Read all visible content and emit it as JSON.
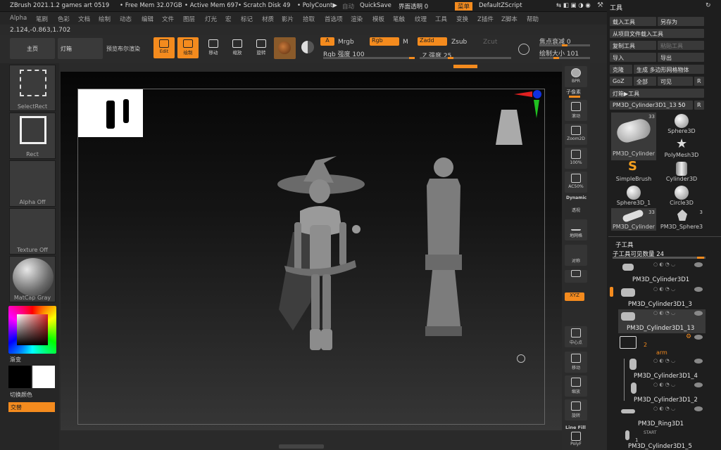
{
  "titlebar": {
    "app": "ZBrush 2021.1.2 games art 0519",
    "free_mem": "• Free Mem 32.07GB",
    "active_mem": "• Active Mem 697",
    "scratch": "• Scratch Disk 49",
    "polycount": "• PolyCount▶",
    "auto": "自动",
    "quicksave": "QuickSave",
    "transparency": "界面透明 0",
    "menu_btn": "菜单",
    "script": "DefaultZScript"
  },
  "menu": [
    "Alpha",
    "笔刷",
    "色彩",
    "文档",
    "绘制",
    "动态",
    "编辑",
    "文件",
    "图层",
    "灯光",
    "宏",
    "标记",
    "材质",
    "影片",
    "拾取",
    "首选项",
    "渲染",
    "模板",
    "笔触",
    "纹理",
    "工具",
    "变换",
    "Z插件",
    "Z脚本",
    "帮助"
  ],
  "coords": "2.124,-0.863,1.702",
  "shelf": {
    "home": "主页",
    "lightbox": "灯箱",
    "preview": "预览布尔渲染",
    "edit": "Edit",
    "draw": "绘制",
    "move": "移动",
    "scale": "缩放",
    "rotate": "旋转",
    "a": "A",
    "mrgb": "Mrgb",
    "rgb": "Rgb",
    "m": "M",
    "zadd": "Zadd",
    "zsub": "Zsub",
    "zcut": "Zcut",
    "rgb_intensity": "Rgb 强度 100",
    "z_intensity": "Z 强度 25",
    "focal": "焦点衰减 0",
    "draw_size": "绘制大小 101"
  },
  "left": {
    "select": "SelectRect",
    "rect": "Rect",
    "alpha": "Alpha Off",
    "texture": "Texture Off",
    "material": "MatCap Gray",
    "gradient": "渐变",
    "switch": "切换颜色",
    "swap": "交替"
  },
  "rightshelf": {
    "bpr": "BPR",
    "subpixel": "子像素",
    "scroll": "滚动",
    "zoom2d": "Zoom2D",
    "hundred": "100%",
    "ac50": "AC50%",
    "dynamic": "Dynamic",
    "persp": "透视",
    "floor": "地网格",
    "local": "对称",
    "xyz": "XYZ",
    "center": "中心点",
    "move": "移动",
    "scale": "缩放",
    "rotate": "旋转",
    "linefill": "Line Fill",
    "polyf": "PolyF"
  },
  "tool": {
    "header": "工具",
    "load": "载入工具",
    "saveas": "另存为",
    "load_proj": "从项目文件载入工具",
    "copy": "复制工具",
    "paste": "粘贴工具",
    "import": "导入",
    "export": "导出",
    "clone": "克隆",
    "make_polymesh": "生成 多边形网格物体",
    "goz": "GoZ",
    "all": "全部",
    "visible": "可见",
    "r": "R",
    "lightbox_tools": "灯箱▶工具",
    "current": "PM3D_Cylinder3D1_13",
    "current_val": "50",
    "thumbs": [
      {
        "name": "PM3D_Cylinder",
        "count": "33"
      },
      {
        "name": "Sphere3D",
        "count": ""
      },
      {
        "name": "PolyMesh3D",
        "count": ""
      },
      {
        "name": "SimpleBrush",
        "count": ""
      },
      {
        "name": "Cylinder3D",
        "count": ""
      },
      {
        "name": "Sphere3D_1",
        "count": ""
      },
      {
        "name": "Circle3D",
        "count": ""
      },
      {
        "name": "PM3D_Cylinder",
        "count": "33"
      },
      {
        "name": "PM3D_Sphere3",
        "count": "3"
      }
    ]
  },
  "subtool": {
    "header": "子工具",
    "visible_count": "子工具可见数量 24",
    "items": [
      "PM3D_Cylinder3D1",
      "PM3D_Cylinder3D1_3",
      "PM3D_Cylinder3D1_13",
      "2",
      "arm",
      "PM3D_Cylinder3D1_4",
      "PM3D_Cylinder3D1_2",
      "PM3D_Ring3D1",
      "START",
      "PM3D_Cylinder3D1_5"
    ],
    "folder_count": "2",
    "folder_name": "arm",
    "start": "START",
    "one": "1"
  }
}
